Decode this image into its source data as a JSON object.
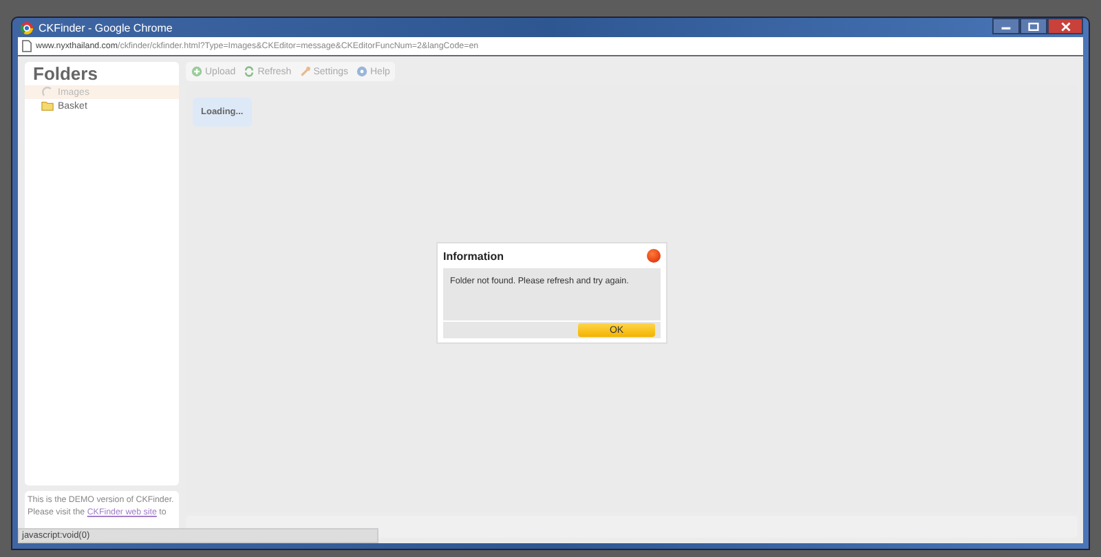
{
  "window": {
    "title": "CKFinder - Google Chrome"
  },
  "address_bar": {
    "host": "www.nyxthailand.com",
    "path": "/ckfinder/ckfinder.html?Type=Images&CKEditor=message&CKEditorFuncNum=2&langCode=en"
  },
  "sidebar": {
    "title": "Folders",
    "items": [
      {
        "label": "Images",
        "selected": true,
        "kind": "loading"
      },
      {
        "label": "Basket",
        "selected": false,
        "kind": "folder"
      }
    ],
    "demo_notice": {
      "before": "This is the DEMO version of CKFinder. Please visit the",
      "link": "CKFinder web site",
      "after": "to"
    }
  },
  "toolbar": [
    {
      "label": "Upload",
      "kind": "upload"
    },
    {
      "label": "Refresh",
      "kind": "refresh"
    },
    {
      "label": "Settings",
      "kind": "settings"
    },
    {
      "label": "Help",
      "kind": "help"
    }
  ],
  "loading": "Loading...",
  "dialog": {
    "title": "Information",
    "message": "Folder not found. Please refresh and try again.",
    "button": "OK"
  },
  "status_bar": "javascript:void(0)"
}
